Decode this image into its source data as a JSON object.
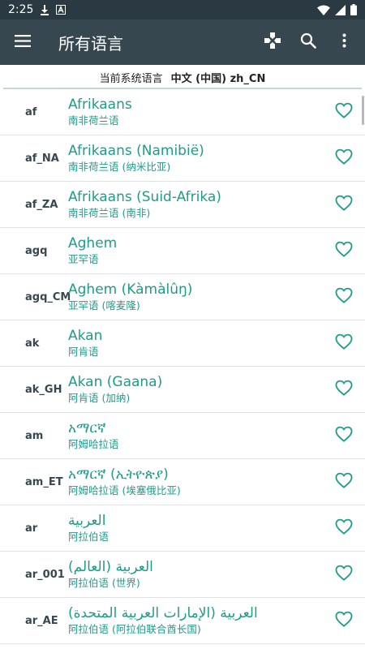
{
  "status_bar": {
    "time": "2:25"
  },
  "app_bar": {
    "title": "所有语言"
  },
  "system_language": {
    "label": "当前系统语言",
    "value": "中文 (中国) zh_CN"
  },
  "colors": {
    "app_bar": "#37474f",
    "status_bar": "#2b3a42",
    "accent": "#1e9c8a"
  },
  "icons": {
    "menu": "menu-icon",
    "gamepad": "gamepad-icon",
    "search": "search-icon",
    "more": "more-vert-icon",
    "favorite": "heart-outline-icon"
  },
  "languages": [
    {
      "code": "af",
      "native": "Afrikaans",
      "local": "南非荷兰语"
    },
    {
      "code": "af_NA",
      "native": "Afrikaans (Namibië)",
      "local": "南非荷兰语 (纳米比亚)"
    },
    {
      "code": "af_ZA",
      "native": "Afrikaans (Suid-Afrika)",
      "local": "南非荷兰语 (南非)"
    },
    {
      "code": "agq",
      "native": "Aghem",
      "local": "亚罕语"
    },
    {
      "code": "agq_CM",
      "native": "Aghem (Kàmàlûŋ)",
      "local": "亚罕语 (喀麦隆)"
    },
    {
      "code": "ak",
      "native": "Akan",
      "local": "阿肯语"
    },
    {
      "code": "ak_GH",
      "native": "Akan (Gaana)",
      "local": "阿肯语 (加纳)"
    },
    {
      "code": "am",
      "native": "አማርኛ",
      "local": "阿姆哈拉语"
    },
    {
      "code": "am_ET",
      "native": "አማርኛ (ኢትዮጵያ)",
      "local": "阿姆哈拉语 (埃塞俄比亚)"
    },
    {
      "code": "ar",
      "native": "العربية",
      "local": "阿拉伯语"
    },
    {
      "code": "ar_001",
      "native": "العربية (العالم)",
      "local": "阿拉伯语 (世界)"
    },
    {
      "code": "ar_AE",
      "native": "العربية (الإمارات العربية المتحدة)",
      "local": "阿拉伯语 (阿拉伯联合酋长国)"
    }
  ]
}
